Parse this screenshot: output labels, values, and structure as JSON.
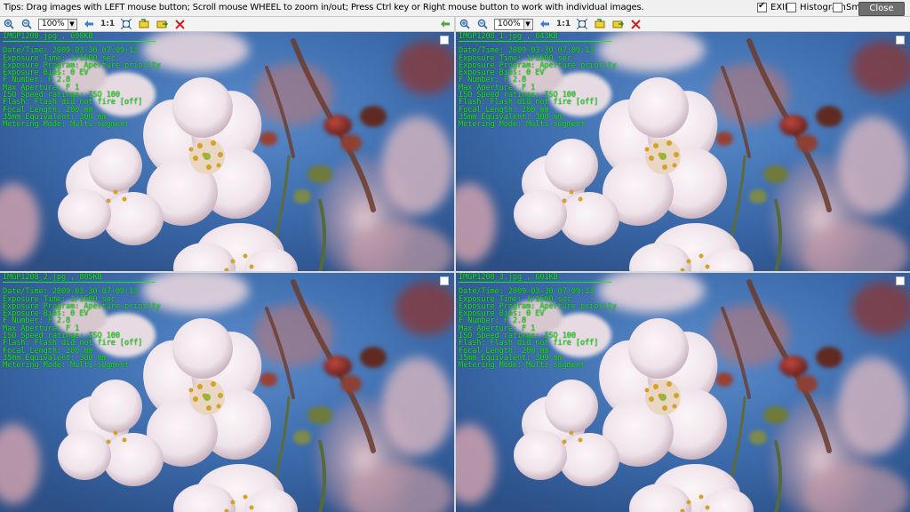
{
  "tips": "Tips: Drag images with LEFT mouse button; Scroll mouse WHEEL to zoom in/out; Press Ctrl key or Right mouse button to work with individual images.",
  "options": {
    "exif": {
      "label": "EXIF",
      "checked": true
    },
    "histogram": {
      "label": "Histogram",
      "checked": false
    },
    "smooth": {
      "label": "Smooth",
      "checked": false
    }
  },
  "close_label": "Close",
  "toolbar": {
    "zoom_value": "100%",
    "ratio_label": "1:1",
    "icons": [
      "zoom-in-icon",
      "zoom-out-icon",
      "fit-icon",
      "actual-size-icon",
      "rotate-left-icon",
      "rotate-right-icon",
      "close-image-icon"
    ]
  },
  "nav_arrow": "←",
  "colors": {
    "exif_text": "#1ee81e",
    "sky": "#3d6fb0",
    "petal": "#f1e8ee",
    "close_button": "#6e6e6e"
  },
  "images": [
    {
      "filename": "IMGP1208.jpg  ,  698KB",
      "exif": [
        "Date/Time: 2009-03-30 07:09:13",
        "Exposure Time: 1/1500 sec",
        "Exposure Program: Aperture priority",
        "Exposure Bias: 0 EV",
        "F Number: F 2.8",
        "Max Aperture: F 1",
        "ISO Speed ratings: ISO 100",
        "Flash: Flash did not fire [off]",
        "Focal Length: 200 mm",
        "35mm Equivalent: 300 mm",
        "Metering Mode: Multi-segment"
      ]
    },
    {
      "filename": "IMGP1208_1.jpg  ,  643KB",
      "exif": [
        "Date/Time: 2009-03-30 07:09:13",
        "Exposure Time: 1/1500 sec",
        "Exposure Program: Aperture priority",
        "Exposure Bias: 0 EV",
        "F Number: F 2.8",
        "Max Aperture: F 1",
        "ISO Speed ratings: ISO 100",
        "Flash: Flash did not fire [off]",
        "Focal Length: 200 mm",
        "35mm Equivalent: 300 mm",
        "Metering Mode: Multi-segment"
      ]
    },
    {
      "filename": "IMGP1208_2.jpg  ,  805KB",
      "exif": [
        "Date/Time: 2009-03-30 07:09:13",
        "Exposure Time: 1/1500 sec",
        "Exposure Program: Aperture priority",
        "Exposure Bias: 0 EV",
        "F Number: F 2.8",
        "Max Aperture: F 1",
        "ISO Speed ratings: ISO 100",
        "Flash: Flash did not fire [off]",
        "Focal Length: 200 mm",
        "35mm Equivalent: 300 mm",
        "Metering Mode: Multi-segment"
      ]
    },
    {
      "filename": "IMGP1208_3.jpg  ,  601KB",
      "exif": [
        "Date/Time: 2009-03-30 07:09:13",
        "Exposure Time: 1/1500 sec",
        "Exposure Program: Aperture priority",
        "Exposure Bias: 0 EV",
        "F Number: F 2.8",
        "Max Aperture: F 1",
        "ISO Speed ratings: ISO 100",
        "Flash: Flash did not fire [off]",
        "Focal Length: 200 mm",
        "35mm Equivalent: 300 mm",
        "Metering Mode: Multi-segment"
      ]
    }
  ]
}
